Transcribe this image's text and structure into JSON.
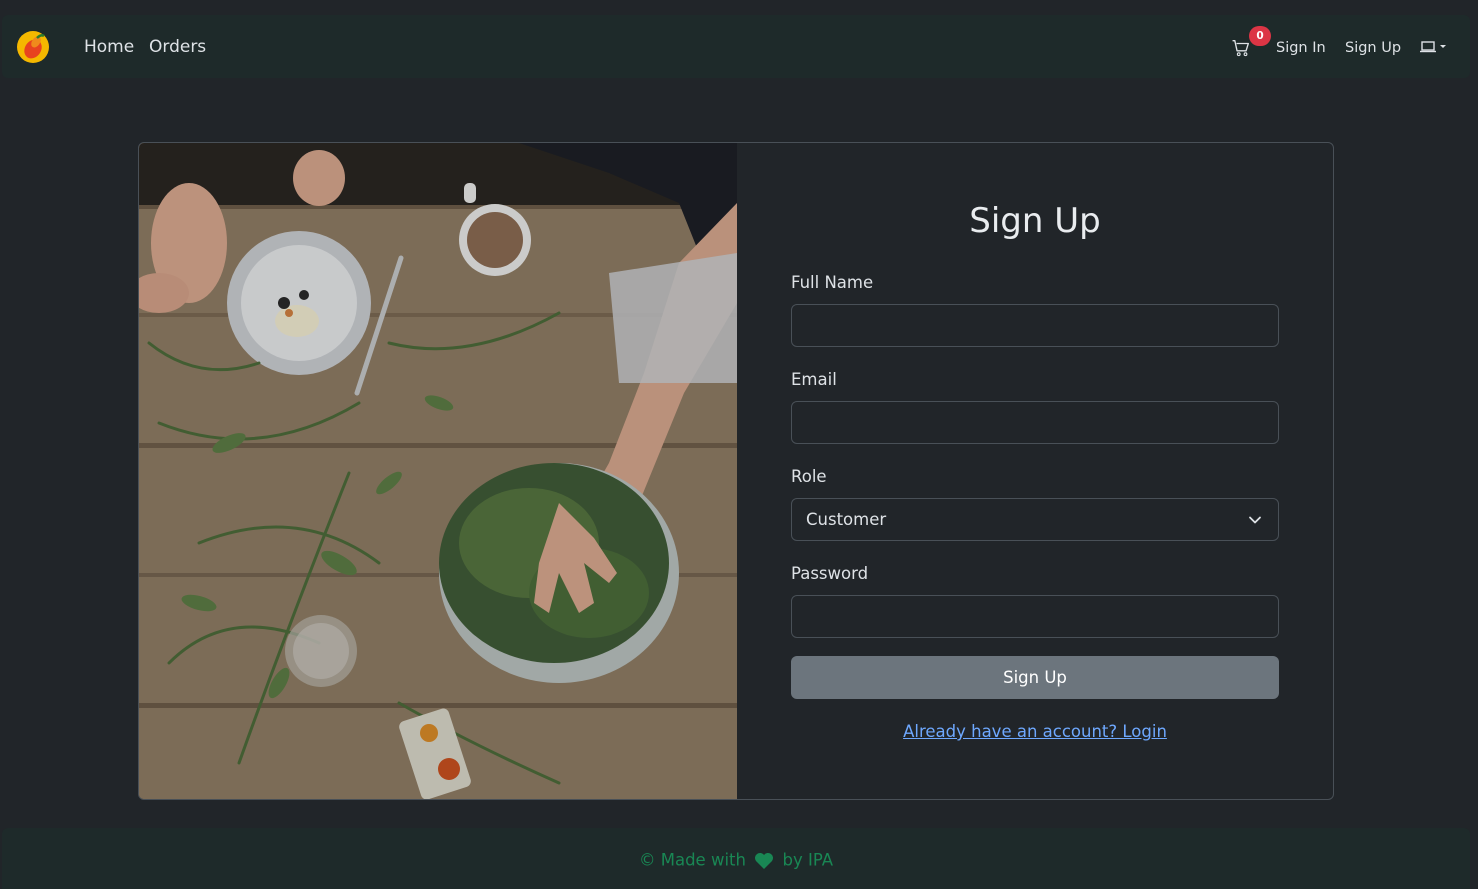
{
  "nav": {
    "home": "Home",
    "orders": "Orders",
    "cart_count": "0",
    "sign_in": "Sign In",
    "sign_up": "Sign Up"
  },
  "form": {
    "title": "Sign Up",
    "full_name_label": "Full Name",
    "full_name_value": "",
    "email_label": "Email",
    "email_value": "",
    "role_label": "Role",
    "role_selected": "Customer",
    "password_label": "Password",
    "password_value": "",
    "submit_label": "Sign Up",
    "login_link": "Already have an account? Login"
  },
  "footer": {
    "copyright": "©",
    "made_with": "Made with",
    "by": "by IPA"
  },
  "colors": {
    "background": "#212529",
    "navbar": "#1e2a2a",
    "badge": "#dc3545",
    "link": "#6ea8fe",
    "footer_text": "#198754",
    "button": "#6c757d"
  },
  "icons": {
    "logo": "mango-logo-icon",
    "cart": "cart-icon",
    "theme": "laptop-icon",
    "select": "chevron-down-icon",
    "heart": "heart-icon"
  }
}
